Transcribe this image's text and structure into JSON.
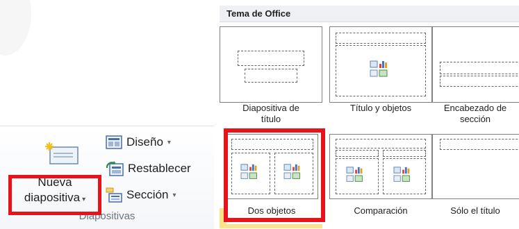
{
  "ribbon": {
    "new_slide": {
      "label_line1": "Nueva",
      "label_line2": "diapositiva",
      "dropdown_glyph": "▾",
      "icon": "new-slide-icon"
    },
    "layout": {
      "label": "Diseño",
      "dropdown_glyph": "▾",
      "icon": "layout-icon"
    },
    "reset": {
      "label": "Restablecer",
      "icon": "reset-icon"
    },
    "section": {
      "label": "Sección",
      "dropdown_glyph": "▾",
      "icon": "section-icon"
    },
    "group_label": "Diapositivas"
  },
  "gallery": {
    "header": "Tema de Office",
    "tiles": [
      {
        "label_line1": "Diapositiva de",
        "label_line2": "título",
        "selected": false
      },
      {
        "label_line1": "Título y objetos",
        "label_line2": "",
        "selected": false
      },
      {
        "label_line1": "Encabezado de",
        "label_line2": "sección",
        "selected": false
      },
      {
        "label_line1": "Dos objetos",
        "label_line2": "",
        "selected": true
      },
      {
        "label_line1": "Comparación",
        "label_line2": "",
        "selected": false
      },
      {
        "label_line1": "Sólo el título",
        "label_line2": "",
        "selected": false
      }
    ]
  },
  "colors": {
    "highlight_red": "#e8121b",
    "selected_fill": "#fbe28c",
    "group_label": "#6b7580"
  }
}
